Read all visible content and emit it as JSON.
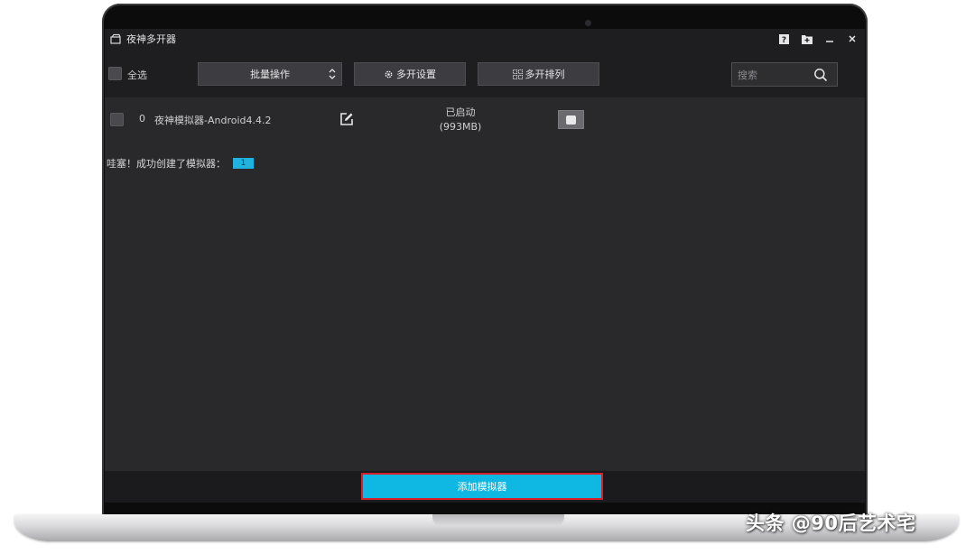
{
  "window": {
    "title": "夜神多开器",
    "controls": [
      "help-icon",
      "folder-add-icon",
      "minimize-icon",
      "close-icon"
    ]
  },
  "toolbar": {
    "select_all_label": "全选",
    "batch_label": "批量操作",
    "settings_label": "多开设置",
    "arrange_label": "多开排列",
    "search_placeholder": "搜索"
  },
  "emulators": [
    {
      "index": "0",
      "name": "夜神模拟器-Android4.4.2",
      "status": "已启动",
      "memory": "(993MB)"
    }
  ],
  "message": {
    "text": "哇塞！成功创建了模拟器：",
    "count": "1"
  },
  "footer": {
    "add_label": "添加模拟器"
  },
  "watermark": "头条 @90后艺术宅",
  "colors": {
    "accent": "#0eb8e3",
    "highlight_border": "#d8202a",
    "badge": "#20b3df",
    "background": "#29292c"
  }
}
